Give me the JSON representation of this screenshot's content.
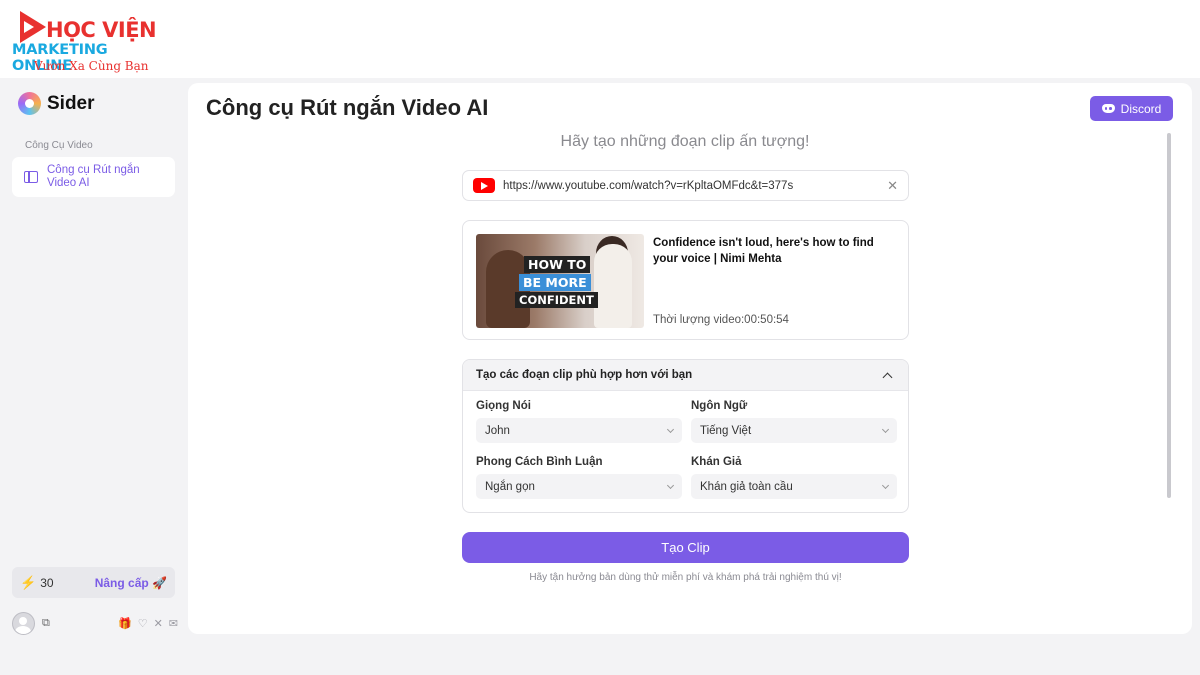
{
  "watermark": {
    "line1": "HỌC VIỆN",
    "line2": "MARKETING ONLINE",
    "line3": "Vươn Xa Cùng Bạn"
  },
  "sidebar": {
    "brand": "Sider",
    "section_label": "Công Cụ Video",
    "items": [
      {
        "label": "Công cụ Rút ngắn Video AI",
        "icon": "video-panel-icon",
        "active": true
      }
    ],
    "credits": {
      "count": "30",
      "upgrade_label": "Nâng cấp"
    }
  },
  "header": {
    "title": "Công cụ Rút ngắn Video AI",
    "discord_label": "Discord"
  },
  "main": {
    "subtitle": "Hãy tạo những đoạn clip ấn tượng!",
    "url_input": {
      "value": "https://www.youtube.com/watch?v=rKpltaOMFdc&t=377s"
    },
    "video": {
      "title": "Confidence isn't loud, here's how to find your voice | Nimi Mehta",
      "duration_label": "Thời lượng video:00:50:54",
      "thumb_text": [
        "HOW TO",
        "BE MORE",
        "CONFIDENT"
      ]
    },
    "options": {
      "heading": "Tạo các đoạn clip phù hợp hơn với bạn",
      "fields": [
        {
          "label": "Giọng Nói",
          "value": "John"
        },
        {
          "label": "Ngôn Ngữ",
          "value": "Tiếng Việt"
        },
        {
          "label": "Phong Cách Bình Luận",
          "value": "Ngắn gọn"
        },
        {
          "label": "Khán Giả",
          "value": "Khán giả toàn cầu"
        }
      ]
    },
    "create_label": "Tạo Clip",
    "note": "Hãy tận hưởng bản dùng thử miễn phí và khám phá trải nghiệm thú vị!"
  },
  "colors": {
    "accent": "#7b5ce6",
    "youtube": "#ff0000",
    "bolt": "#25b79b"
  }
}
